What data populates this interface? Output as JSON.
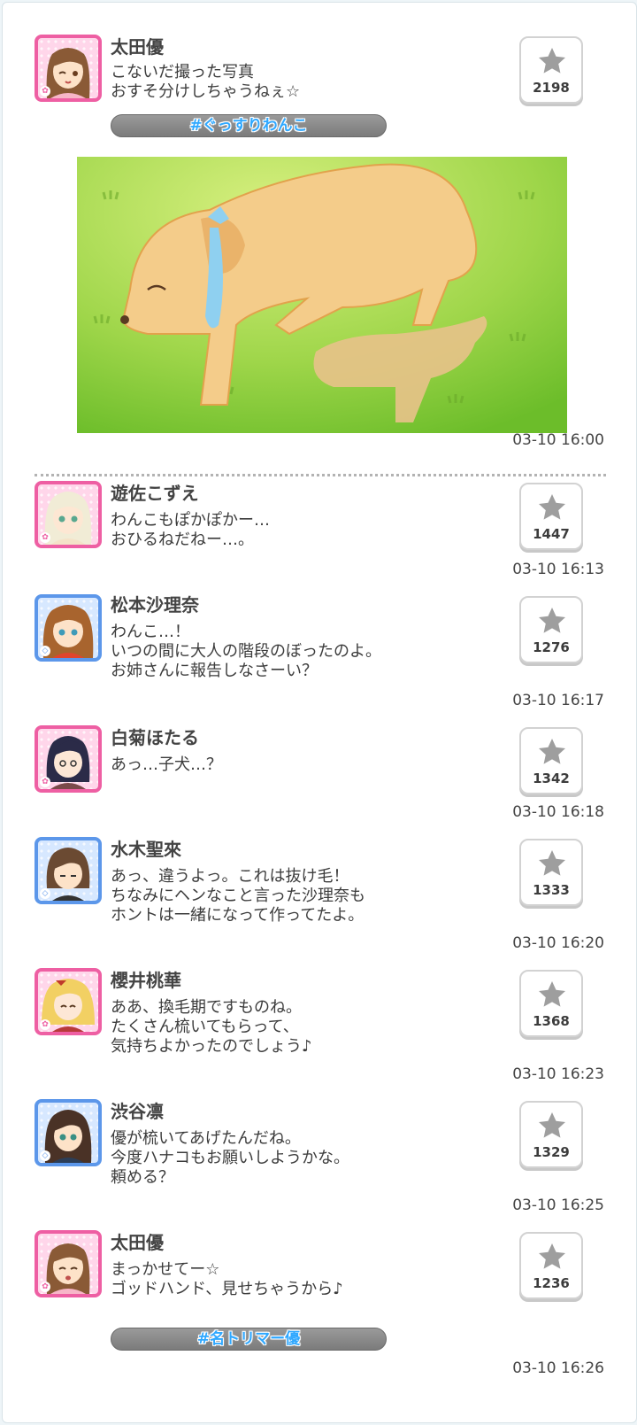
{
  "colors": {
    "pink_frame": "#ee5fa3",
    "blue_frame": "#5c97ea",
    "tag_text": "#2fa8ff",
    "star": "#9e9e9e"
  },
  "posts": [
    {
      "name": "太田優",
      "text": "こないだ撮った写真\nおすそ分けしちゃうねぇ☆",
      "likes": "2198",
      "time": "03-10 16:00",
      "tag": "#ぐっすりわんこ"
    },
    {
      "name": "遊佐こずえ",
      "text": "わんこもぽかぽかー…\nおひるねだねー…。",
      "likes": "1447",
      "time": "03-10 16:13"
    },
    {
      "name": "松本沙理奈",
      "text": "わんこ…！\nいつの間に大人の階段のぼったのよ。\nお姉さんに報告しなさーい？",
      "likes": "1276",
      "time": "03-10 16:17"
    },
    {
      "name": "白菊ほたる",
      "text": "あっ…子犬…？",
      "likes": "1342",
      "time": "03-10 16:18"
    },
    {
      "name": "水木聖來",
      "text": "あっ、違うよっ。これは抜け毛！\nちなみにヘンなこと言った沙理奈も\nホントは一緒になって作ってたよ。",
      "likes": "1333",
      "time": "03-10 16:20"
    },
    {
      "name": "櫻井桃華",
      "text": "ああ、換毛期ですものね。\nたくさん梳いてもらって、\n気持ちよかったのでしょう♪",
      "likes": "1368",
      "time": "03-10 16:23"
    },
    {
      "name": "渋谷凛",
      "text": "優が梳いてあげたんだね。\n今度ハナコもお願いしようかな。\n頼める？",
      "likes": "1329",
      "time": "03-10 16:25"
    },
    {
      "name": "太田優",
      "text": "まっかせてー☆\nゴッドハンド、見せちゃうから♪",
      "likes": "1236",
      "time": "03-10 16:26",
      "tag": "#名トリマー優"
    }
  ]
}
